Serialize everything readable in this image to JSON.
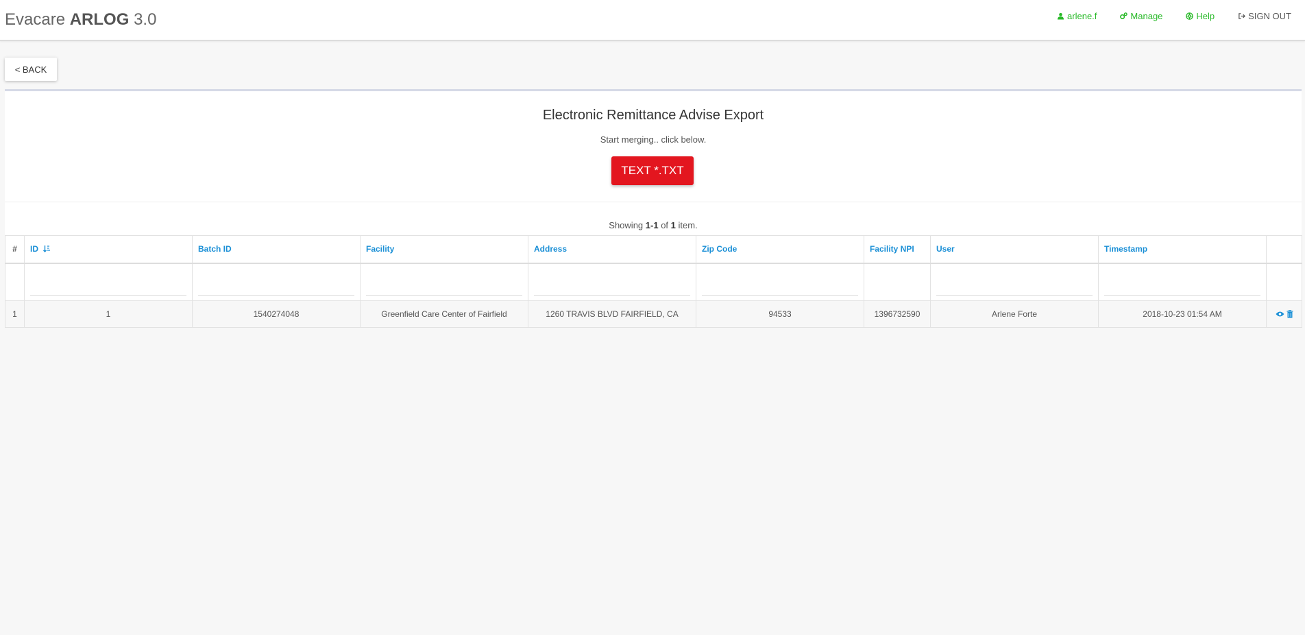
{
  "brand": {
    "prefix": "Evacare",
    "name": "ARLOG",
    "version": "3.0"
  },
  "nav": {
    "user": "arlene.f",
    "manage": "Manage",
    "help": "Help",
    "signout": "SIGN OUT"
  },
  "back_label": "< BACK",
  "panel": {
    "title": "Electronic Remittance Advise Export",
    "subtitle": "Start merging.. click below.",
    "button_label": "TEXT *.TXT"
  },
  "summary": {
    "prefix": "Showing",
    "range": "1-1",
    "of": "of",
    "total": "1",
    "suffix": "item."
  },
  "table": {
    "columns": [
      "#",
      "ID",
      "Batch ID",
      "Facility",
      "Address",
      "Zip Code",
      "Facility NPI",
      "User",
      "Timestamp"
    ],
    "rows": [
      {
        "num": "1",
        "id": "1",
        "batch_id": "1540274048",
        "facility": "Greenfield Care Center of Fairfield",
        "address": "1260 TRAVIS BLVD FAIRFIELD, CA",
        "zip": "94533",
        "npi": "1396732590",
        "user": "Arlene Forte",
        "timestamp": "2018-10-23 01:54 AM"
      }
    ]
  },
  "colors": {
    "accent_green": "#28b928",
    "link_blue": "#1a8fd6",
    "button_red": "#e3161f"
  },
  "icons": [
    "user-icon",
    "cogs-icon",
    "life-ring-icon",
    "sign-out-icon",
    "sort-icon",
    "eye-icon",
    "trash-icon"
  ]
}
